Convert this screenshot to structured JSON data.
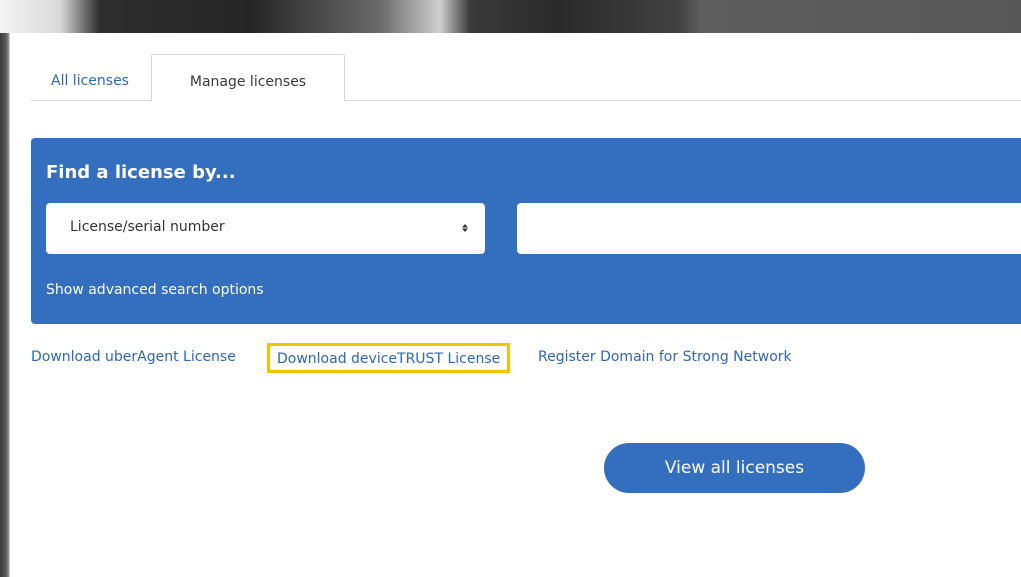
{
  "tabs": {
    "all_licenses": "All licenses",
    "manage_licenses": "Manage licenses"
  },
  "search": {
    "title": "Find a license by...",
    "select_value": "License/serial number",
    "input_value": "",
    "input_placeholder": "",
    "advanced_link": "Show advanced search options"
  },
  "links": {
    "uberagent": "Download uberAgent License",
    "devicetrust": "Download deviceTRUST License",
    "register_domain": "Register Domain for Strong Network"
  },
  "buttons": {
    "view_all": "View all licenses"
  },
  "colors": {
    "accent": "#346fbf",
    "link": "#2e67b8",
    "highlight": "#f4c300"
  }
}
